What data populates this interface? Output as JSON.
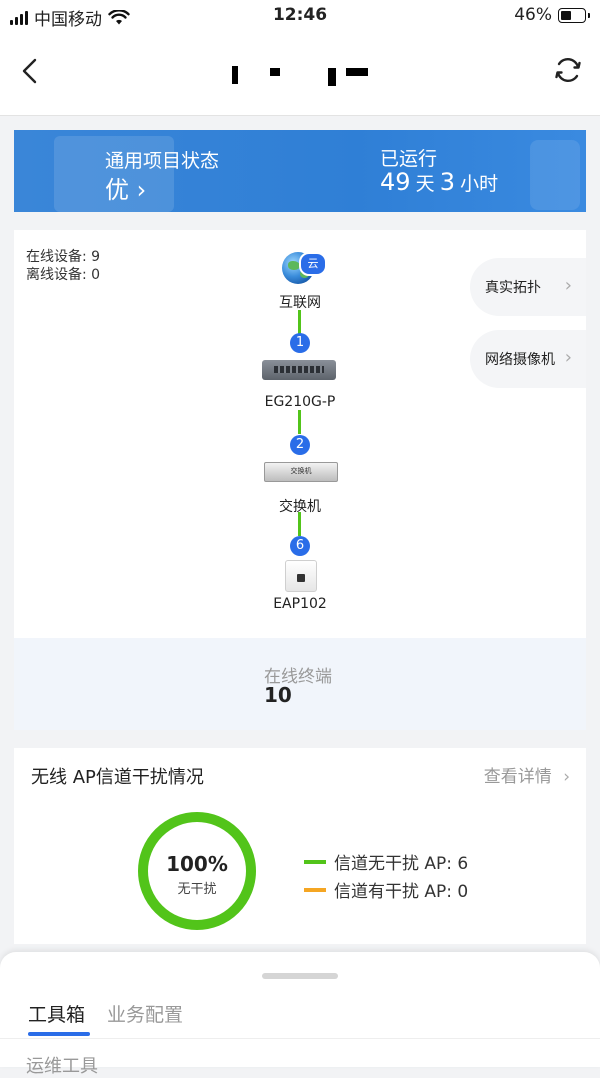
{
  "status_bar": {
    "carrier": "中国移动",
    "time": "12:46",
    "battery": "46%",
    "battery_level": 0.46
  },
  "banner": {
    "status_label": "通用项目状态",
    "status_value": "优 ›",
    "uptime_label": "已运行",
    "uptime_days": "49",
    "days_unit": "天",
    "uptime_hours": "3",
    "hours_unit": "小时"
  },
  "topology": {
    "online_devices": "在线设备: 9",
    "offline_devices": "离线设备: 0",
    "internet_badge": "云",
    "nodes": {
      "internet": "互联网",
      "gateway": "EG210G-P",
      "switch": "交换机",
      "switch_face": "交换机",
      "ap": "EAP102"
    },
    "links": [
      "1",
      "2",
      "6"
    ],
    "side_buttons": [
      "真实拓扑",
      "网络摄像机"
    ]
  },
  "online_terminals": {
    "label": "在线终端",
    "value": "10"
  },
  "ap_interference": {
    "title": "无线 AP信道干扰情况",
    "more": "查看详情",
    "percent": "100%",
    "percent_label": "无干扰",
    "legend": [
      {
        "label": "信道无干扰 AP: 6",
        "color": "#52c41a"
      },
      {
        "label": "信道有干扰 AP: 0",
        "color": "#f5a623"
      }
    ]
  },
  "bottom_sheet": {
    "tabs": [
      "工具箱",
      "业务配置"
    ],
    "section_peek": "运维工具"
  }
}
